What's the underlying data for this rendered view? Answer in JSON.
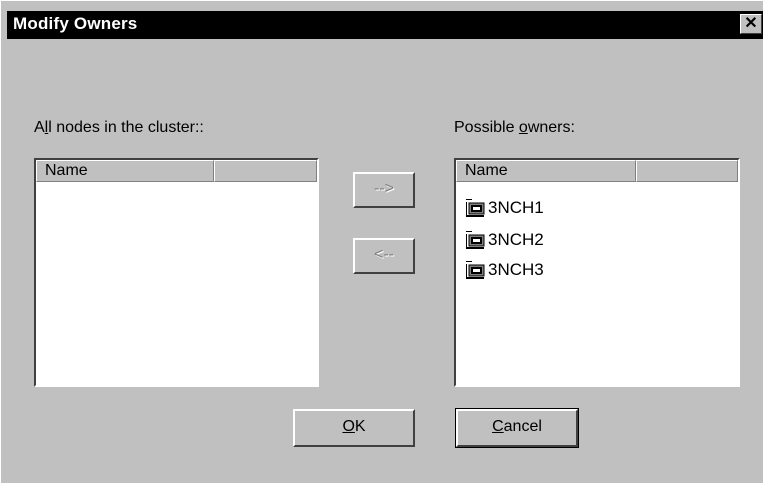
{
  "window": {
    "title": "Modify Owners",
    "close_glyph": "✕"
  },
  "left_panel": {
    "label_prefix": "A",
    "label_mnemonic": "l",
    "label_suffix": "l nodes in the cluster::",
    "columns": [
      "Name",
      ""
    ],
    "items": []
  },
  "right_panel": {
    "label_prefix": "Possible ",
    "label_mnemonic": "o",
    "label_suffix": "wners:",
    "columns": [
      "Name",
      ""
    ],
    "items": [
      {
        "name": "3NCH1",
        "icon": "cluster-node-icon"
      },
      {
        "name": "3NCH2",
        "icon": "cluster-node-icon"
      },
      {
        "name": "3NCH3",
        "icon": "cluster-node-icon"
      }
    ]
  },
  "transfer": {
    "add_label": "-->",
    "remove_label": "<--"
  },
  "buttons": {
    "ok_mnemonic": "O",
    "ok_rest": "K",
    "cancel_mnemonic": "C",
    "cancel_rest": "ancel"
  }
}
